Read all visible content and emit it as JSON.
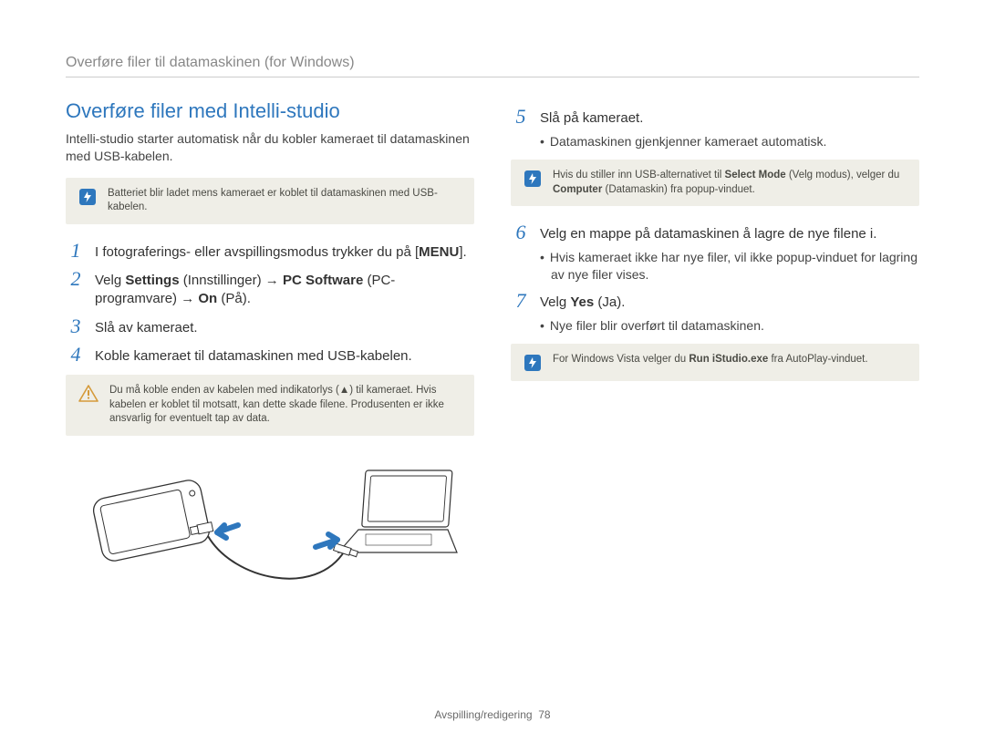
{
  "breadcrumb": "Overføre filer til datamaskinen (for Windows)",
  "left": {
    "title": "Overføre filer med Intelli-studio",
    "intro": "Intelli-studio starter automatisk når du kobler kameraet til datamaskinen med USB-kabelen.",
    "note1_html": "Batteriet blir ladet mens kameraet er koblet til datamaskinen med USB-kabelen.",
    "step1_html": "I fotograferings- eller avspillingsmodus trykker du på [<strong class='k'>MENU</strong>].",
    "step2_html": "Velg <strong class='k'>Settings</strong> (Innstillinger) <span class='arrow'>→</span> <strong class='k'>PC Software</strong> (PC-programvare) <span class='arrow'>→</span> <strong class='k'>On</strong> (På).",
    "step3_html": "Slå av kameraet.",
    "step4_html": "Koble kameraet til datamaskinen med USB-kabelen.",
    "warn_html": "Du må koble enden av kabelen med indikatorlys (▲) til kameraet. Hvis kabelen er koblet til motsatt, kan dette skade filene. Produsenten er ikke ansvarlig for eventuelt tap av data."
  },
  "right": {
    "step5_html": "Slå på kameraet.",
    "step5_sub": "Datamaskinen gjenkjenner kameraet automatisk.",
    "note5_html": "Hvis du stiller inn USB-alternativet til <strong class='k'>Select Mode</strong> (Velg modus), velger du <strong class='k'>Computer</strong> (Datamaskin) fra popup-vinduet.",
    "step6_html": "Velg en mappe på datamaskinen å lagre de nye filene i.",
    "step6_sub": "Hvis kameraet ikke har nye filer, vil ikke popup-vinduet for lagring av nye filer vises.",
    "step7_html": "Velg <strong class='k'>Yes</strong> (Ja).",
    "step7_sub": "Nye filer blir overført til datamaskinen.",
    "note_vista_html": "For Windows Vista velger du <strong class='k'>Run iStudio.exe</strong> fra AutoPlay-vinduet."
  },
  "footer": {
    "section": "Avspilling/redigering",
    "page": "78"
  }
}
